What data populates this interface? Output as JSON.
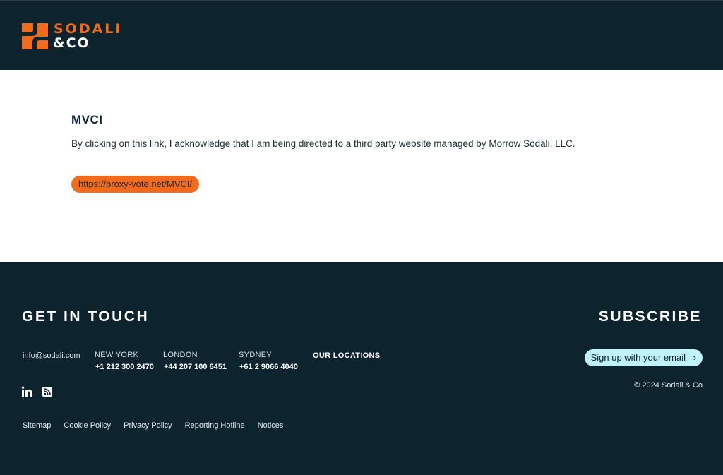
{
  "header": {
    "logo_line1": "SODALI",
    "logo_line2": "&CO",
    "brand_color": "#f26a1b",
    "background_color": "#0d232d"
  },
  "main": {
    "title": "MVCI",
    "description": "By clicking on this link, I acknowledge that I am being directed to a third party website managed by Morrow Sodali, LLC.",
    "link_label": "https://proxy-vote.net/MVCI/",
    "link_color": "#f26a1b"
  },
  "footer": {
    "get_in_touch": "GET IN TOUCH",
    "subscribe": "SUBSCRIBE",
    "email": "info@sodali.com",
    "locations": [
      {
        "city": "NEW YORK",
        "phone": "+1 212 300 2470"
      },
      {
        "city": "LONDON",
        "phone": "+44 207 100 6451"
      },
      {
        "city": "SYDNEY",
        "phone": "+61 2 9066 4040"
      }
    ],
    "our_locations": "OUR LOCATIONS",
    "social_icons": [
      "linkedin-icon",
      "rss-icon"
    ],
    "signup_label": "Sign up with your email",
    "signup_color": "#bff3f7",
    "copyright": "© 2024 Sodali & Co",
    "legal_links": [
      "Sitemap",
      "Cookie Policy",
      "Privacy Policy",
      "Reporting Hotline",
      "Notices"
    ]
  }
}
